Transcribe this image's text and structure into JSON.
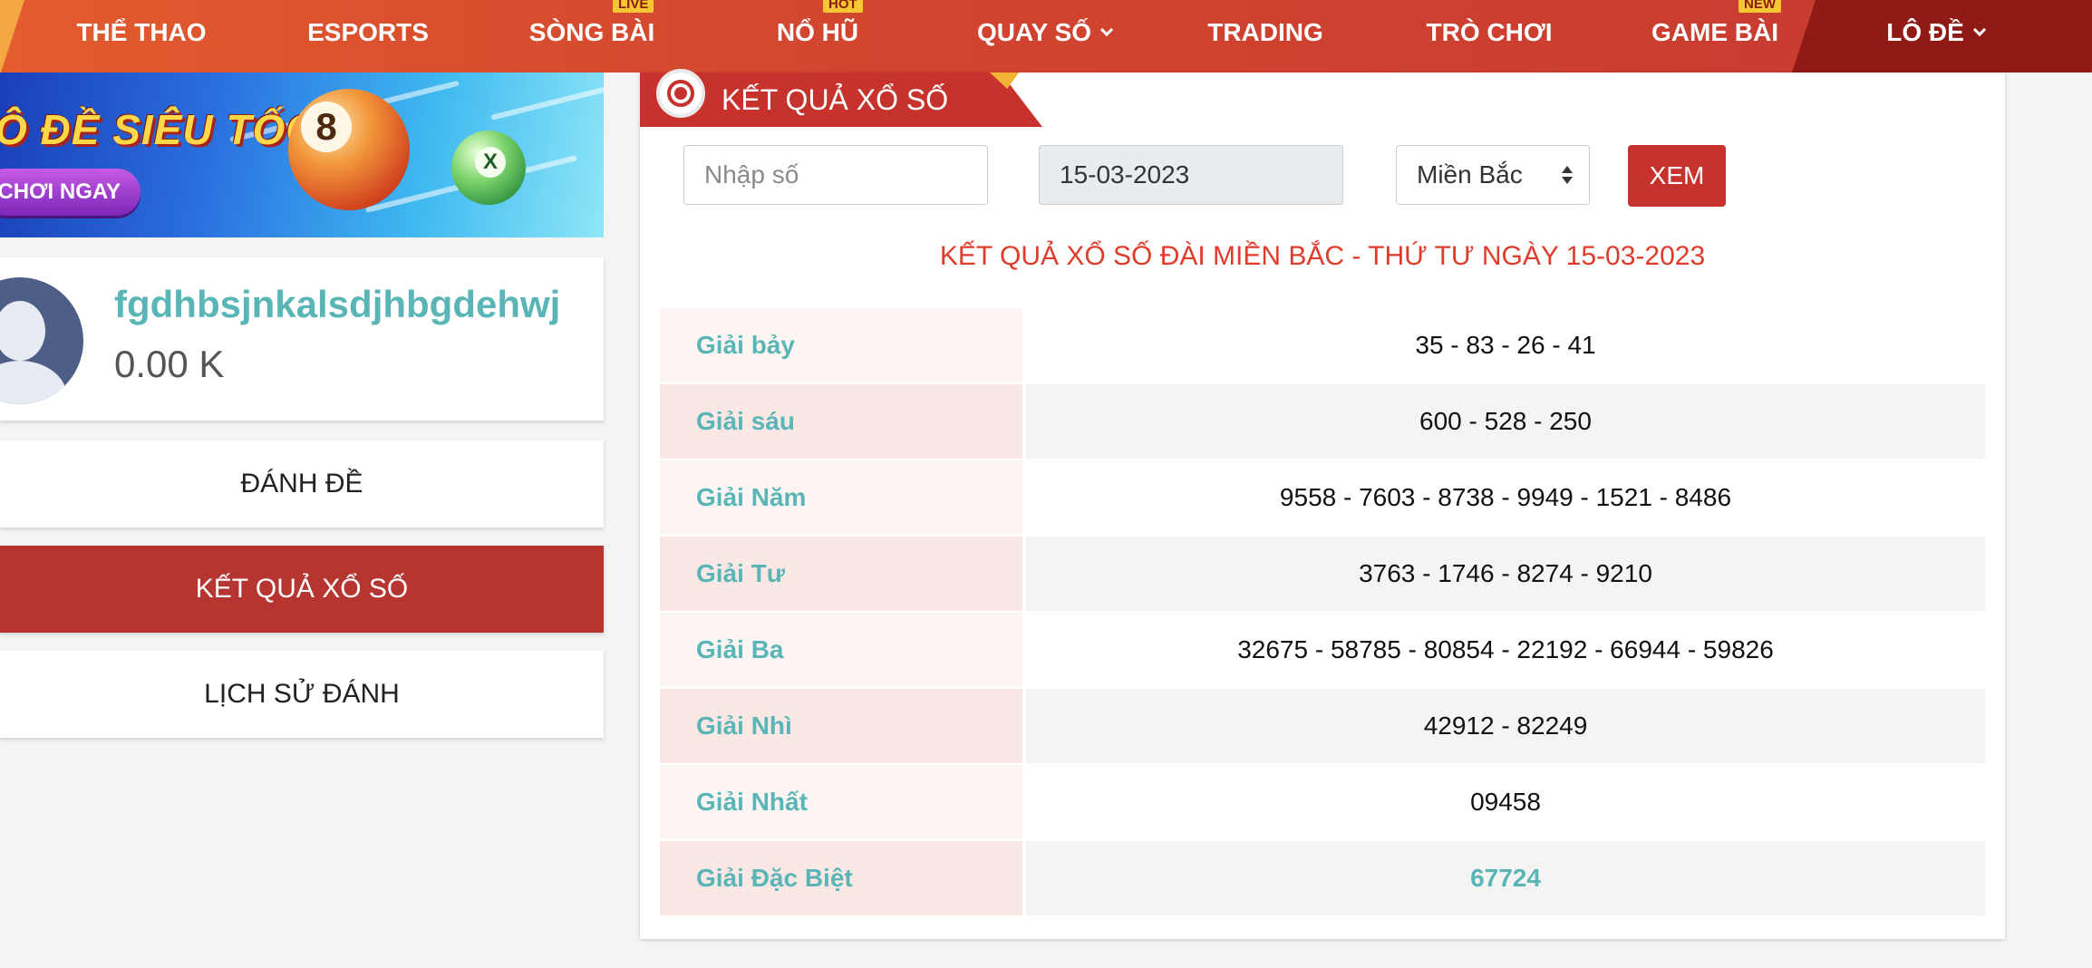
{
  "nav": {
    "items": [
      {
        "label": "THỂ THAO",
        "badge": "",
        "dropdown": false
      },
      {
        "label": "ESPORTS",
        "badge": "",
        "dropdown": false
      },
      {
        "label": "SÒNG BÀI",
        "badge": "LIVE",
        "dropdown": false
      },
      {
        "label": "NỔ HŨ",
        "badge": "HOT",
        "dropdown": false
      },
      {
        "label": "QUAY SỐ",
        "badge": "",
        "dropdown": true
      },
      {
        "label": "TRADING",
        "badge": "",
        "dropdown": false
      },
      {
        "label": "TRÒ CHƠI",
        "badge": "",
        "dropdown": false
      },
      {
        "label": "GAME BÀI",
        "badge": "NEW",
        "dropdown": false
      }
    ],
    "last_item": {
      "label": "LÔ ĐỀ",
      "dropdown": true
    }
  },
  "banner": {
    "title": "Ô ĐỀ SIÊU TỐC",
    "cta": "CHƠI NGAY",
    "ball_big_number": "8",
    "ball_small_number": "X"
  },
  "user": {
    "username": "fgdhbsjnkalsdjhbgdehwj",
    "balance": "0.00 K"
  },
  "side_menu": [
    {
      "label": "ĐÁNH ĐỀ",
      "active": false
    },
    {
      "label": "KẾT QUẢ XỔ SỐ",
      "active": true
    },
    {
      "label": "LỊCH SỬ ĐÁNH",
      "active": false
    }
  ],
  "panel": {
    "title": "KẾT QUẢ XỔ SỐ",
    "number_input_placeholder": "Nhập số",
    "date_value": "15-03-2023",
    "region_value": "Miền Bắc",
    "submit_label": "XEM",
    "result_heading": "KẾT QUẢ XỔ SỐ ĐÀI MIỀN BẮC - THỨ TƯ NGÀY 15-03-2023"
  },
  "results": [
    {
      "prize": "Giải bảy",
      "numbers": "35 - 83 - 26 - 41"
    },
    {
      "prize": "Giải sáu",
      "numbers": "600 - 528 - 250"
    },
    {
      "prize": "Giải Năm",
      "numbers": "9558 - 7603 - 8738 - 9949 - 1521 - 8486"
    },
    {
      "prize": "Giải Tư",
      "numbers": "3763 - 1746 - 8274 - 9210"
    },
    {
      "prize": "Giải Ba",
      "numbers": "32675 - 58785 - 80854 - 22192 - 66944 - 59826"
    },
    {
      "prize": "Giải Nhì",
      "numbers": "42912 - 82249"
    },
    {
      "prize": "Giải Nhất",
      "numbers": "09458"
    },
    {
      "prize": "Giải Đặc Biệt",
      "numbers": "67724"
    }
  ],
  "colors": {
    "nav_gradient_start": "#e25c2e",
    "nav_gradient_end": "#c63a30",
    "primary_red": "#c8322c",
    "teal_text": "#5ab6b6",
    "heading_red": "#e03c2b",
    "badge_yellow": "#f6c633"
  }
}
